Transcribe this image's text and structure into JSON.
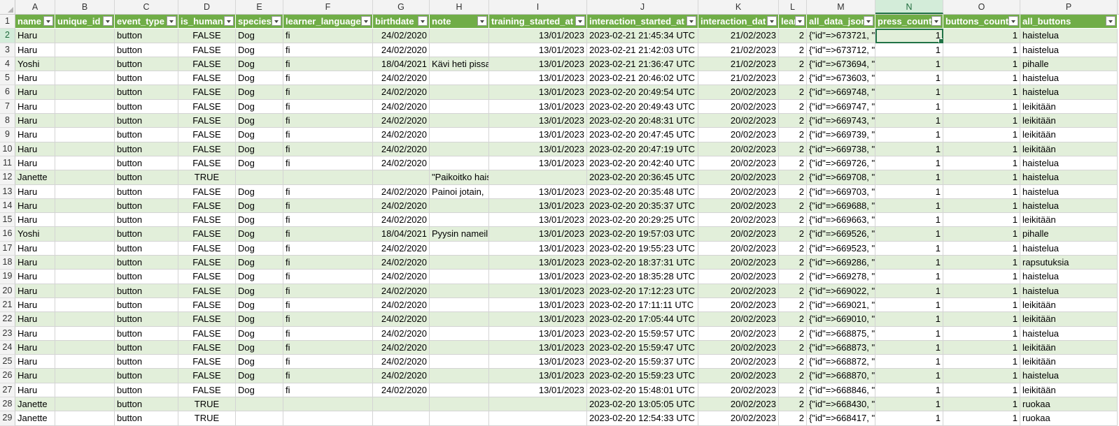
{
  "columns": [
    {
      "letter": "A",
      "w": 57
    },
    {
      "letter": "B",
      "w": 85
    },
    {
      "letter": "C",
      "w": 91
    },
    {
      "letter": "D",
      "w": 82
    },
    {
      "letter": "E",
      "w": 68
    },
    {
      "letter": "F",
      "w": 128
    },
    {
      "letter": "G",
      "w": 81
    },
    {
      "letter": "H",
      "w": 85
    },
    {
      "letter": "I",
      "w": 140
    },
    {
      "letter": "J",
      "w": 159
    },
    {
      "letter": "K",
      "w": 115
    },
    {
      "letter": "L",
      "w": 40
    },
    {
      "letter": "M",
      "w": 98
    },
    {
      "letter": "N",
      "w": 97
    },
    {
      "letter": "O",
      "w": 110
    },
    {
      "letter": "P",
      "w": 139
    }
  ],
  "selected_column": "N",
  "selected_cell": {
    "row": 2,
    "col": "N"
  },
  "align": [
    "l",
    "l",
    "l",
    "c",
    "l",
    "l",
    "r",
    "l",
    "r",
    "l",
    "r",
    "r",
    "l",
    "r",
    "r",
    "l"
  ],
  "header_row": {
    "num": "1",
    "cells": [
      "name",
      "unique_id",
      "event_type",
      "is_human",
      "species",
      "learner_language",
      "birthdate",
      "note",
      "training_started_at",
      "interaction_started_at",
      "interaction_dat",
      "lear",
      "all_data_json",
      "press_count",
      "buttons_count",
      "all_buttons"
    ]
  },
  "rows": [
    {
      "num": "2",
      "cells": [
        "Haru",
        "",
        "button",
        "FALSE",
        "Dog",
        "fi",
        "24/02/2020",
        "",
        "13/01/2023",
        "2023-02-21 21:45:34 UTC",
        "21/02/2023",
        "2",
        "{\"id\"=>673721, \"",
        "1",
        "1",
        "haistelua"
      ]
    },
    {
      "num": "3",
      "cells": [
        "Haru",
        "",
        "button",
        "FALSE",
        "Dog",
        "fi",
        "24/02/2020",
        "",
        "13/01/2023",
        "2023-02-21 21:42:03 UTC",
        "21/02/2023",
        "2",
        "{\"id\"=>673712, \"",
        "1",
        "1",
        "haistelua"
      ]
    },
    {
      "num": "4",
      "cells": [
        "Yoshi",
        "",
        "button",
        "FALSE",
        "Dog",
        "fi",
        "18/04/2021",
        "Kävi heti pissa",
        "13/01/2023",
        "2023-02-21 21:36:47 UTC",
        "21/02/2023",
        "2",
        "{\"id\"=>673694, \"",
        "1",
        "1",
        "pihalle"
      ]
    },
    {
      "num": "5",
      "cells": [
        "Haru",
        "",
        "button",
        "FALSE",
        "Dog",
        "fi",
        "24/02/2020",
        "",
        "13/01/2023",
        "2023-02-21 20:46:02 UTC",
        "21/02/2023",
        "2",
        "{\"id\"=>673603, \"",
        "1",
        "1",
        "haistelua"
      ]
    },
    {
      "num": "6",
      "cells": [
        "Haru",
        "",
        "button",
        "FALSE",
        "Dog",
        "fi",
        "24/02/2020",
        "",
        "13/01/2023",
        "2023-02-20 20:49:54 UTC",
        "20/02/2023",
        "2",
        "{\"id\"=>669748, \"",
        "1",
        "1",
        "haistelua"
      ]
    },
    {
      "num": "7",
      "cells": [
        "Haru",
        "",
        "button",
        "FALSE",
        "Dog",
        "fi",
        "24/02/2020",
        "",
        "13/01/2023",
        "2023-02-20 20:49:43 UTC",
        "20/02/2023",
        "2",
        "{\"id\"=>669747, \"",
        "1",
        "1",
        "leikitään"
      ]
    },
    {
      "num": "8",
      "cells": [
        "Haru",
        "",
        "button",
        "FALSE",
        "Dog",
        "fi",
        "24/02/2020",
        "",
        "13/01/2023",
        "2023-02-20 20:48:31 UTC",
        "20/02/2023",
        "2",
        "{\"id\"=>669743, \"",
        "1",
        "1",
        "leikitään"
      ]
    },
    {
      "num": "9",
      "cells": [
        "Haru",
        "",
        "button",
        "FALSE",
        "Dog",
        "fi",
        "24/02/2020",
        "",
        "13/01/2023",
        "2023-02-20 20:47:45 UTC",
        "20/02/2023",
        "2",
        "{\"id\"=>669739, \"",
        "1",
        "1",
        "leikitään"
      ]
    },
    {
      "num": "10",
      "cells": [
        "Haru",
        "",
        "button",
        "FALSE",
        "Dog",
        "fi",
        "24/02/2020",
        "",
        "13/01/2023",
        "2023-02-20 20:47:19 UTC",
        "20/02/2023",
        "2",
        "{\"id\"=>669738, \"",
        "1",
        "1",
        "leikitään"
      ]
    },
    {
      "num": "11",
      "cells": [
        "Haru",
        "",
        "button",
        "FALSE",
        "Dog",
        "fi",
        "24/02/2020",
        "",
        "13/01/2023",
        "2023-02-20 20:42:40 UTC",
        "20/02/2023",
        "2",
        "{\"id\"=>669726, \"",
        "1",
        "1",
        "haistelua"
      ]
    },
    {
      "num": "12",
      "cells": [
        "Janette",
        "",
        "button",
        "TRUE",
        "",
        "",
        "",
        "\"Paikoitko haistelua\"",
        "",
        "2023-02-20 20:36:45 UTC",
        "20/02/2023",
        "2",
        "{\"id\"=>669708, \"",
        "1",
        "1",
        "haistelua"
      ]
    },
    {
      "num": "13",
      "cells": [
        "Haru",
        "",
        "button",
        "FALSE",
        "Dog",
        "fi",
        "24/02/2020",
        "Painoi jotain,",
        "13/01/2023",
        "2023-02-20 20:35:48 UTC",
        "20/02/2023",
        "2",
        "{\"id\"=>669703, \"",
        "1",
        "1",
        "haistelua"
      ]
    },
    {
      "num": "14",
      "cells": [
        "Haru",
        "",
        "button",
        "FALSE",
        "Dog",
        "fi",
        "24/02/2020",
        "",
        "13/01/2023",
        "2023-02-20 20:35:37 UTC",
        "20/02/2023",
        "2",
        "{\"id\"=>669688, \"",
        "1",
        "1",
        "haistelua"
      ]
    },
    {
      "num": "15",
      "cells": [
        "Haru",
        "",
        "button",
        "FALSE",
        "Dog",
        "fi",
        "24/02/2020",
        "",
        "13/01/2023",
        "2023-02-20 20:29:25 UTC",
        "20/02/2023",
        "2",
        "{\"id\"=>669663, \"",
        "1",
        "1",
        "leikitään"
      ]
    },
    {
      "num": "16",
      "cells": [
        "Yoshi",
        "",
        "button",
        "FALSE",
        "Dog",
        "fi",
        "18/04/2021",
        "Pyysin nameil",
        "13/01/2023",
        "2023-02-20 19:57:03 UTC",
        "20/02/2023",
        "2",
        "{\"id\"=>669526, \"",
        "1",
        "1",
        "pihalle"
      ]
    },
    {
      "num": "17",
      "cells": [
        "Haru",
        "",
        "button",
        "FALSE",
        "Dog",
        "fi",
        "24/02/2020",
        "",
        "13/01/2023",
        "2023-02-20 19:55:23 UTC",
        "20/02/2023",
        "2",
        "{\"id\"=>669523, \"",
        "1",
        "1",
        "haistelua"
      ]
    },
    {
      "num": "18",
      "cells": [
        "Haru",
        "",
        "button",
        "FALSE",
        "Dog",
        "fi",
        "24/02/2020",
        "",
        "13/01/2023",
        "2023-02-20 18:37:31 UTC",
        "20/02/2023",
        "2",
        "{\"id\"=>669286, \"",
        "1",
        "1",
        "rapsutuksia"
      ]
    },
    {
      "num": "19",
      "cells": [
        "Haru",
        "",
        "button",
        "FALSE",
        "Dog",
        "fi",
        "24/02/2020",
        "",
        "13/01/2023",
        "2023-02-20 18:35:28 UTC",
        "20/02/2023",
        "2",
        "{\"id\"=>669278, \"",
        "1",
        "1",
        "haistelua"
      ]
    },
    {
      "num": "20",
      "cells": [
        "Haru",
        "",
        "button",
        "FALSE",
        "Dog",
        "fi",
        "24/02/2020",
        "",
        "13/01/2023",
        "2023-02-20 17:12:23 UTC",
        "20/02/2023",
        "2",
        "{\"id\"=>669022, \"",
        "1",
        "1",
        "haistelua"
      ]
    },
    {
      "num": "21",
      "cells": [
        "Haru",
        "",
        "button",
        "FALSE",
        "Dog",
        "fi",
        "24/02/2020",
        "",
        "13/01/2023",
        "2023-02-20 17:11:11 UTC",
        "20/02/2023",
        "2",
        "{\"id\"=>669021, \"",
        "1",
        "1",
        "leikitään"
      ]
    },
    {
      "num": "22",
      "cells": [
        "Haru",
        "",
        "button",
        "FALSE",
        "Dog",
        "fi",
        "24/02/2020",
        "",
        "13/01/2023",
        "2023-02-20 17:05:44 UTC",
        "20/02/2023",
        "2",
        "{\"id\"=>669010, \"",
        "1",
        "1",
        "leikitään"
      ]
    },
    {
      "num": "23",
      "cells": [
        "Haru",
        "",
        "button",
        "FALSE",
        "Dog",
        "fi",
        "24/02/2020",
        "",
        "13/01/2023",
        "2023-02-20 15:59:57 UTC",
        "20/02/2023",
        "2",
        "{\"id\"=>668875, \"",
        "1",
        "1",
        "haistelua"
      ]
    },
    {
      "num": "24",
      "cells": [
        "Haru",
        "",
        "button",
        "FALSE",
        "Dog",
        "fi",
        "24/02/2020",
        "",
        "13/01/2023",
        "2023-02-20 15:59:47 UTC",
        "20/02/2023",
        "2",
        "{\"id\"=>668873, \"",
        "1",
        "1",
        "leikitään"
      ]
    },
    {
      "num": "25",
      "cells": [
        "Haru",
        "",
        "button",
        "FALSE",
        "Dog",
        "fi",
        "24/02/2020",
        "",
        "13/01/2023",
        "2023-02-20 15:59:37 UTC",
        "20/02/2023",
        "2",
        "{\"id\"=>668872, \"",
        "1",
        "1",
        "leikitään"
      ]
    },
    {
      "num": "26",
      "cells": [
        "Haru",
        "",
        "button",
        "FALSE",
        "Dog",
        "fi",
        "24/02/2020",
        "",
        "13/01/2023",
        "2023-02-20 15:59:23 UTC",
        "20/02/2023",
        "2",
        "{\"id\"=>668870, \"",
        "1",
        "1",
        "haistelua"
      ]
    },
    {
      "num": "27",
      "cells": [
        "Haru",
        "",
        "button",
        "FALSE",
        "Dog",
        "fi",
        "24/02/2020",
        "",
        "13/01/2023",
        "2023-02-20 15:48:01 UTC",
        "20/02/2023",
        "2",
        "{\"id\"=>668846, \"",
        "1",
        "1",
        "leikitään"
      ]
    },
    {
      "num": "28",
      "cells": [
        "Janette",
        "",
        "button",
        "TRUE",
        "",
        "",
        "",
        "",
        "",
        "2023-02-20 13:05:05 UTC",
        "20/02/2023",
        "2",
        "{\"id\"=>668430, \"",
        "1",
        "1",
        "ruokaa"
      ]
    },
    {
      "num": "29",
      "cells": [
        "Janette",
        "",
        "button",
        "TRUE",
        "",
        "",
        "",
        "",
        "",
        "2023-02-20 12:54:33 UTC",
        "20/02/2023",
        "2",
        "{\"id\"=>668417, \"",
        "1",
        "1",
        "ruokaa"
      ]
    }
  ]
}
